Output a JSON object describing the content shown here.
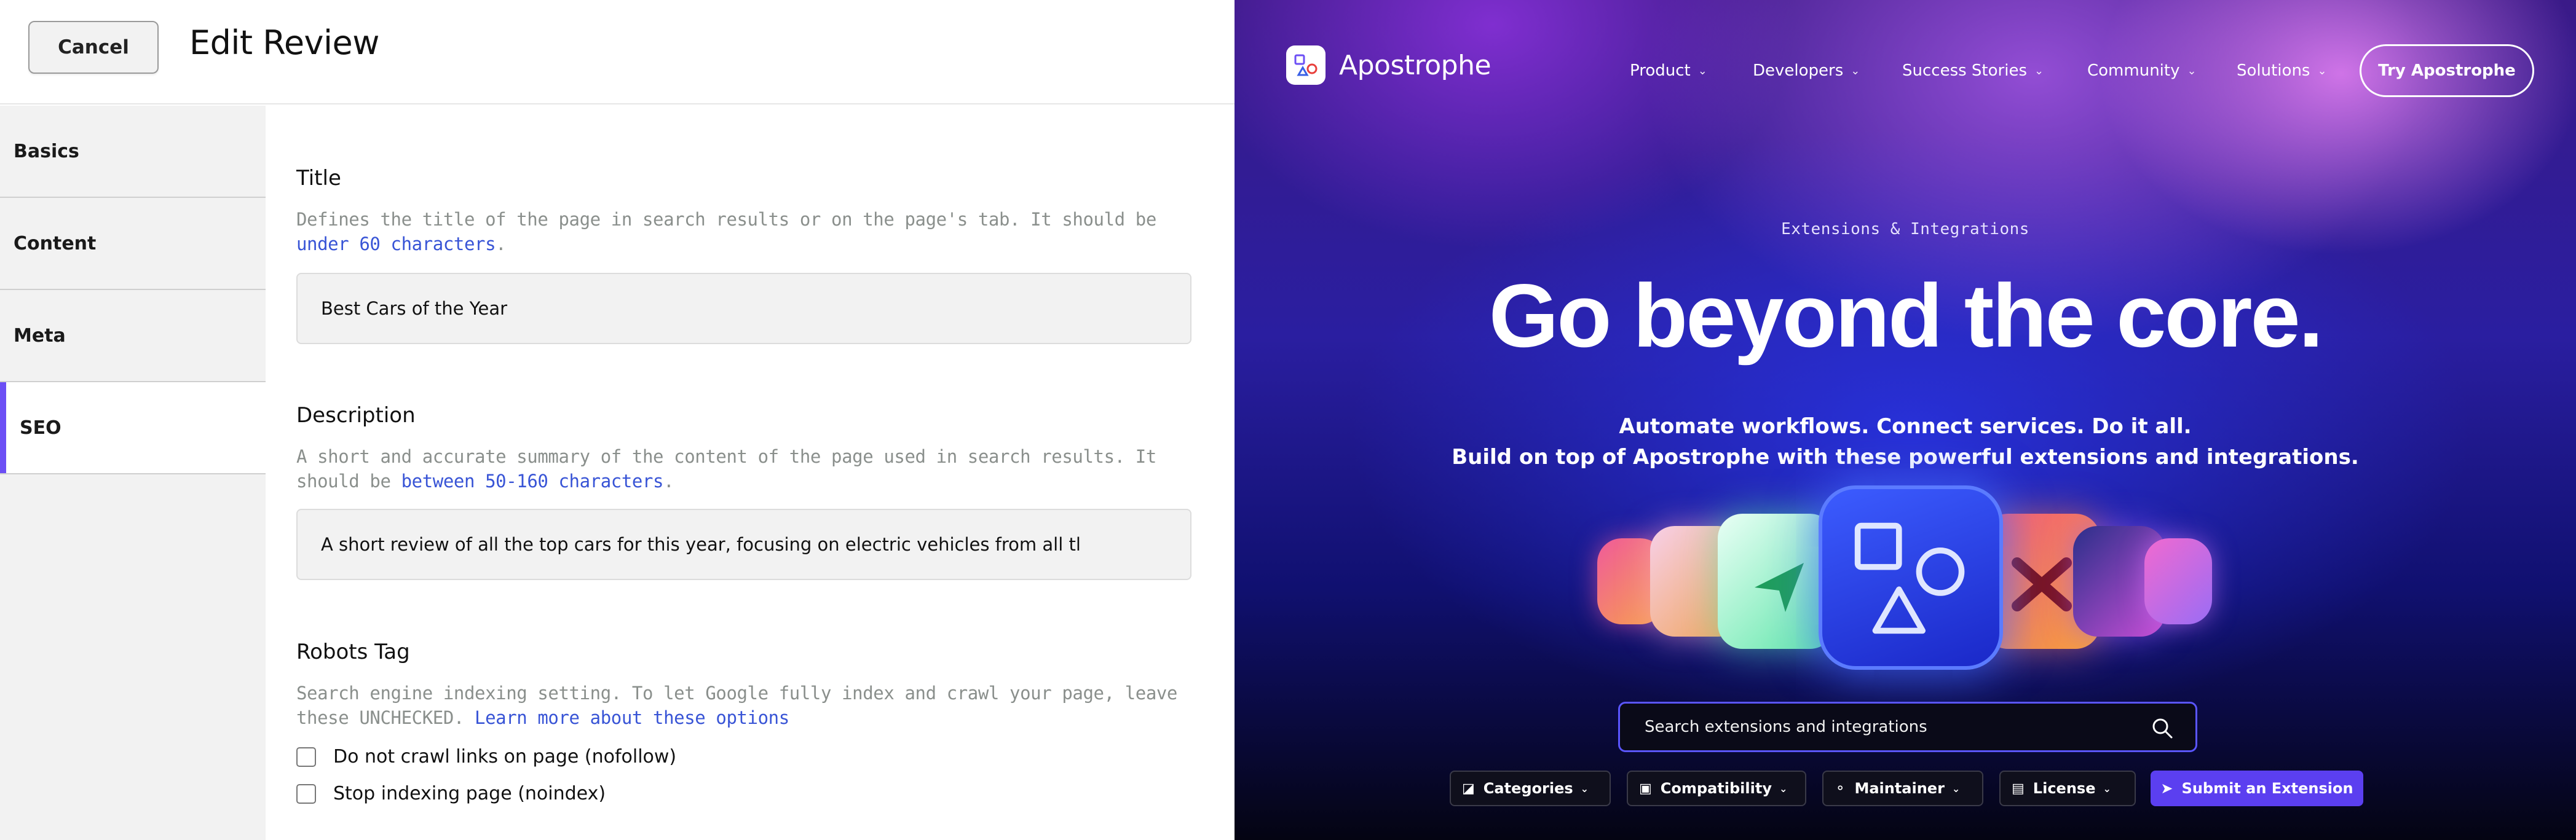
{
  "editor": {
    "cancel_label": "Cancel",
    "title": "Edit Review",
    "tabs": [
      {
        "label": "Basics",
        "active": false
      },
      {
        "label": "Content",
        "active": false
      },
      {
        "label": "Meta",
        "active": false
      },
      {
        "label": "SEO",
        "active": true
      }
    ],
    "fields": {
      "title": {
        "label": "Title",
        "help_prefix": "Defines the title of the page in search results or on the page's tab. It should be ",
        "help_link": "under 60 characters",
        "help_suffix": ".",
        "value": "Best Cars of the Year"
      },
      "description": {
        "label": "Description",
        "help_prefix": "A short and accurate summary of the content of the page used in search results. It should be ",
        "help_link": "between 50-160 characters",
        "help_suffix": ".",
        "value": "A short review of all the top cars for this year, focusing on electric vehicles from all tl"
      },
      "robots": {
        "label": "Robots Tag",
        "help_prefix": "Search engine indexing setting. To let Google fully index and crawl your page, leave these UNCHECKED. ",
        "help_link": "Learn more about these options",
        "options": [
          {
            "label": "Do not crawl links on page (nofollow)",
            "checked": false
          },
          {
            "label": "Stop indexing page (noindex)",
            "checked": false
          }
        ]
      }
    },
    "colors": {
      "accent": "#6c4ff5",
      "link": "#3854d6"
    }
  },
  "site": {
    "brand": "Apostrophe",
    "nav": [
      "Product",
      "Developers",
      "Success Stories",
      "Community",
      "Solutions"
    ],
    "cta": "Try Apostrophe",
    "eyebrow": "Extensions & Integrations",
    "headline": "Go beyond the core.",
    "sub1": "Automate workflows. Connect services. Do it all.",
    "sub2": "Build on top of Apostrophe with these powerful extensions and integrations.",
    "search_placeholder": "Search extensions and integrations",
    "filters": [
      {
        "label": "Categories",
        "icon": "cube-icon"
      },
      {
        "label": "Compatibility",
        "icon": "blocks-icon"
      },
      {
        "label": "Maintainer",
        "icon": "people-icon"
      },
      {
        "label": "License",
        "icon": "document-icon"
      }
    ],
    "submit_label": "Submit an Extension",
    "colors": {
      "primary": "#5b3ff0",
      "search_border": "#5a55ff"
    }
  }
}
